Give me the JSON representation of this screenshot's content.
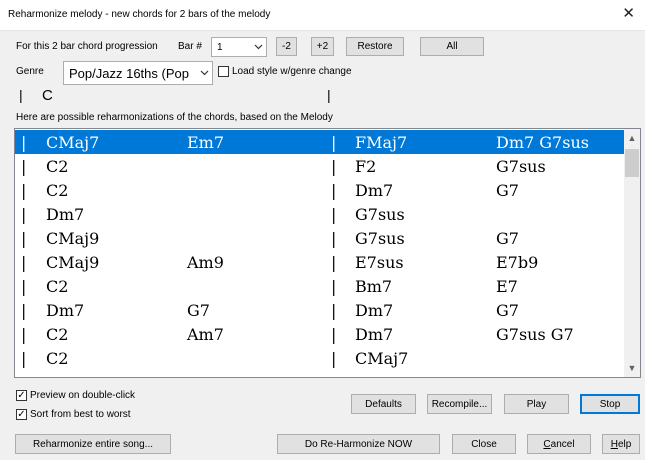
{
  "window": {
    "title": "Reharmonize melody - new chords for 2 bars of the melody",
    "close_glyph": "✕"
  },
  "controls": {
    "progression_label": "For this 2 bar chord progression",
    "bar_label": "Bar #",
    "bar_value": "1",
    "minus2": "-2",
    "plus2": "+2",
    "restore": "Restore",
    "all": "All",
    "genre_label": "Genre",
    "genre_value": "Pop/Jazz 16ths (Pop",
    "load_style_label": "Load style w/genre change",
    "load_style_checked": false,
    "current_bar_prefix": "|",
    "current_chord": "C",
    "current_bar_suffix": "|",
    "possible_label": "Here are possible reharmonizations of the chords, based on the Melody"
  },
  "reharmonizations": [
    {
      "c1": "CMaj7",
      "c2": "Em7",
      "c3": "FMaj7",
      "c4": "Dm7 G7sus",
      "selected": true
    },
    {
      "c1": "C2",
      "c2": "",
      "c3": "F2",
      "c4": "G7sus",
      "selected": false
    },
    {
      "c1": "C2",
      "c2": "",
      "c3": "Dm7",
      "c4": "G7",
      "selected": false
    },
    {
      "c1": "Dm7",
      "c2": "",
      "c3": "G7sus",
      "c4": "",
      "selected": false
    },
    {
      "c1": "CMaj9",
      "c2": "",
      "c3": "G7sus",
      "c4": "G7",
      "selected": false
    },
    {
      "c1": "CMaj9",
      "c2": "Am9",
      "c3": "E7sus",
      "c4": "E7b9",
      "selected": false
    },
    {
      "c1": "C2",
      "c2": "",
      "c3": "Bm7",
      "c4": "E7",
      "selected": false
    },
    {
      "c1": "Dm7",
      "c2": "G7",
      "c3": "Dm7",
      "c4": "G7",
      "selected": false
    },
    {
      "c1": "C2",
      "c2": "Am7",
      "c3": "Dm7",
      "c4": "G7sus G7",
      "selected": false
    },
    {
      "c1": "C2",
      "c2": "",
      "c3": "CMaj7",
      "c4": "",
      "selected": false
    }
  ],
  "bar_separator": "|",
  "options": {
    "preview_label": "Preview on double-click",
    "preview_checked": true,
    "sort_label": "Sort from best to worst",
    "sort_checked": true,
    "check_glyph": "✓"
  },
  "buttons": {
    "defaults": "Defaults",
    "recompile": "Recompile...",
    "play": "Play",
    "stop": "Stop",
    "reharm_song": "Reharmonize entire song...",
    "do_reharm": "Do Re-Harmonize NOW",
    "close": "Close",
    "cancel_first": "C",
    "cancel_rest": "ancel",
    "help_first": "H",
    "help_rest": "elp"
  },
  "icons": {
    "chevron_down": "⌄",
    "scroll_up": "▲",
    "scroll_down": "▼"
  }
}
